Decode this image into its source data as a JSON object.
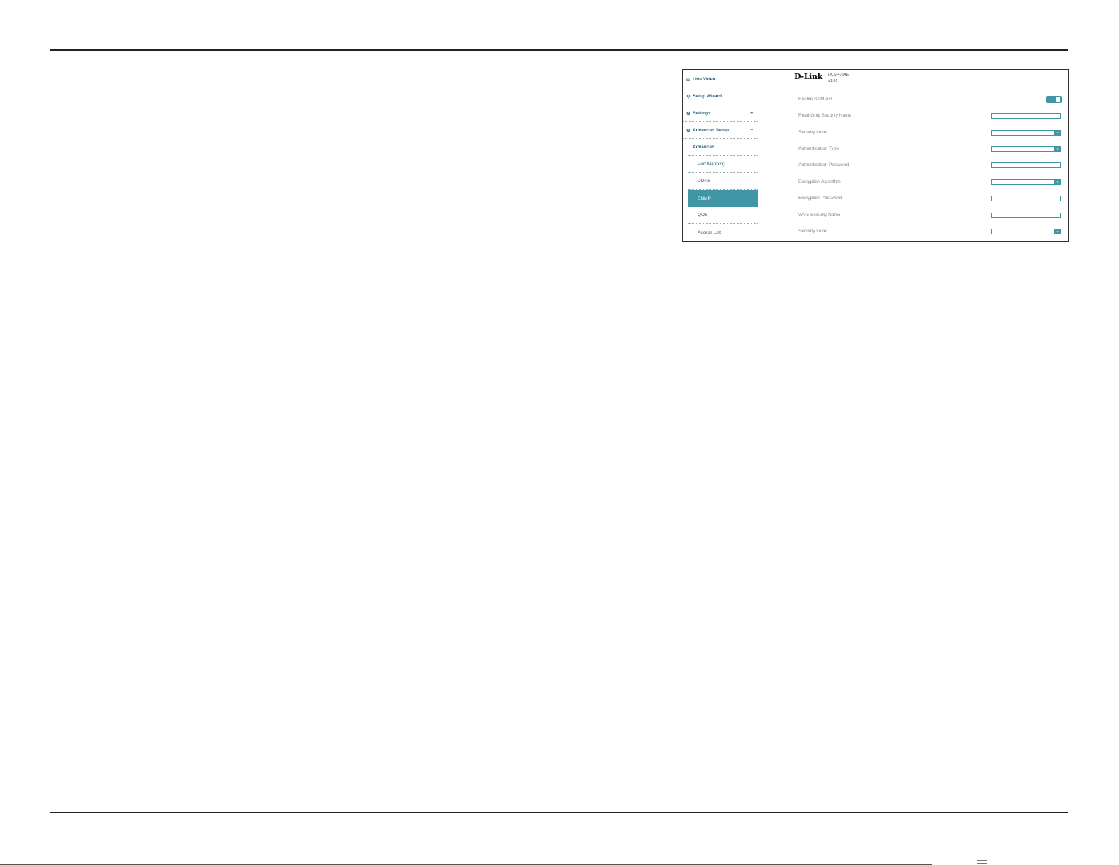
{
  "sidebar": {
    "live_video": "Live Video",
    "setup_wizard": "Setup Wizard",
    "settings": "Settings",
    "settings_toggle": "+",
    "advanced_setup": "Advanced Setup",
    "advanced_setup_toggle": "−",
    "advanced_header": "Advanced",
    "items": [
      "Port Mapping",
      "DDNS",
      "SNMP",
      "QOS",
      "Access List"
    ],
    "active_item": "SNMP"
  },
  "header": {
    "logo": "D-Link",
    "model": "DCS-4714E",
    "version": "v1.01"
  },
  "form": {
    "enable_snmpv3": "Enable SNMPv3",
    "enable_snmpv3_on": true,
    "read_only_security_name": "Read Only Security Name",
    "security_level_1": "Security Level",
    "authentication_type": "Authentication Type",
    "authentication_password": "Authentication Password",
    "encryption_algorithm": "Encryption Algorithm",
    "encryption_password": "Encryption Password",
    "write_security_name": "Write Security Name",
    "security_level_2": "Security Level"
  },
  "colors": {
    "accent": "#4196a6",
    "nav_text": "#1f5f7a"
  }
}
